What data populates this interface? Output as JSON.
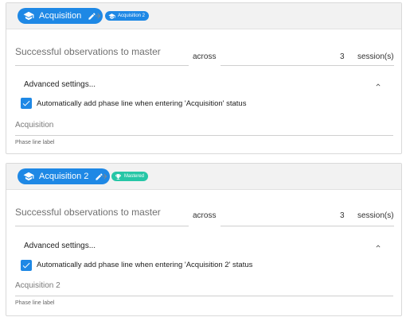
{
  "colors": {
    "primary": "#1e88e5",
    "mastered": "#26c6a6",
    "header_bg": "#f2f2f2"
  },
  "phases": [
    {
      "name": "Acquisition",
      "phase_icon": "graduation-cap-icon",
      "next_chip": {
        "label": "Acquisition 2",
        "icon": "graduation-cap-icon",
        "color": "#1e88e5"
      },
      "observations_label": "Successful observations to master",
      "across_label": "across",
      "session_count": "3",
      "sessions_label": "session(s)",
      "advanced_label": "Advanced settings...",
      "auto_add_checked": true,
      "auto_add_label": "Automatically add phase line when entering 'Acquisition' status",
      "phase_line_value": "Acquisition",
      "phase_line_helper": "Phase line label"
    },
    {
      "name": "Acquisition 2",
      "phase_icon": "graduation-cap-icon",
      "next_chip": {
        "label": "Mastered",
        "icon": "trophy-icon",
        "color": "#26c6a6"
      },
      "observations_label": "Successful observations to master",
      "across_label": "across",
      "session_count": "3",
      "sessions_label": "session(s)",
      "advanced_label": "Advanced settings...",
      "auto_add_checked": true,
      "auto_add_label": "Automatically add phase line when entering 'Acquisition 2' status",
      "phase_line_value": "Acquisition 2",
      "phase_line_helper": "Phase line label"
    }
  ]
}
